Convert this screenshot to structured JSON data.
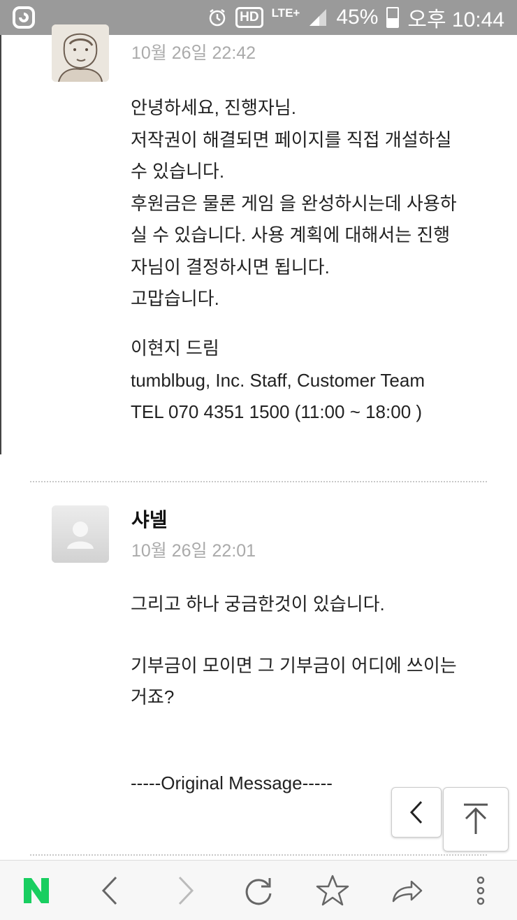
{
  "status_bar": {
    "battery": "45%",
    "time": "오후 10:44",
    "network": "LTE+",
    "hd": "HD"
  },
  "messages": [
    {
      "date": "10월 26일 22:42",
      "body_lines": [
        "안녕하세요, 진행자님.",
        "저작권이 해결되면 페이지를 직접 개설하실",
        "수 있습니다.",
        "후원금은 물론 게임 을 완성하시는데 사용하",
        "실 수 있습니다. 사용 계획에 대해서는 진행",
        "자님이 결정하시면 됩니다.",
        "고맙습니다."
      ],
      "signature_lines": [
        "이현지 드림",
        "tumblbug, Inc. Staff, Customer Team",
        "TEL 070 4351 1500 (11:00 ~ 18:00 )"
      ]
    },
    {
      "author": "샤넬",
      "date": "10월 26일 22:01",
      "body_line_1": "그리고 하나 궁금한것이 있습니다.",
      "body_line_2a": "기부금이 모이면 그 기부금이 어디에 쓰이는",
      "body_line_2b": "거죠?",
      "original_message": "-----Original Message-----"
    }
  ],
  "icons": {
    "status_left": "naver-app-icon",
    "nav_home": "N",
    "nav_back": "chevron-left-icon",
    "nav_forward": "chevron-right-icon",
    "nav_refresh": "refresh-icon",
    "nav_bookmark": "star-icon",
    "nav_share": "share-icon",
    "nav_more": "more-vertical-icon",
    "fab_back": "chevron-left-icon",
    "fab_top": "scroll-to-top-icon"
  },
  "colors": {
    "status_bar": "#9a9a9a",
    "naver_green": "#19ce60",
    "date_gray": "#aaaaaa"
  }
}
